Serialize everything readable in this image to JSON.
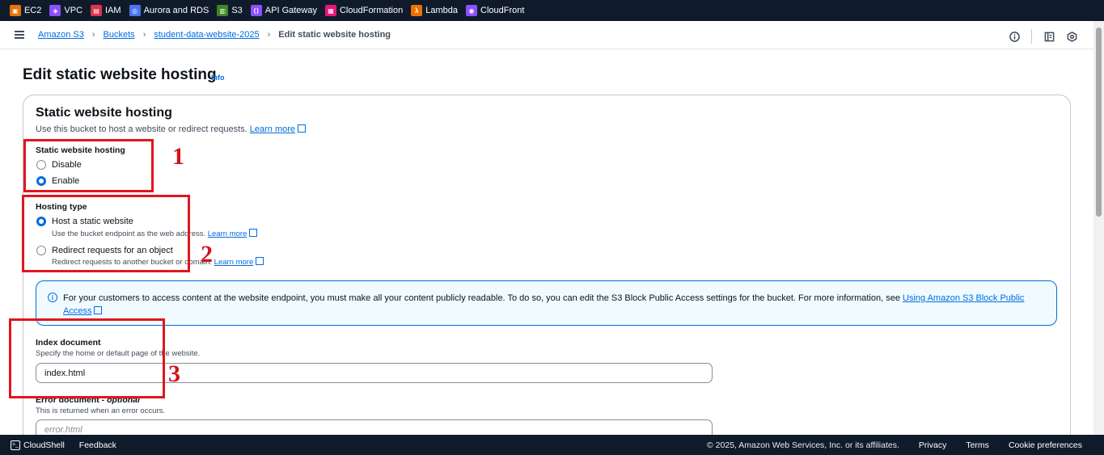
{
  "services": [
    {
      "label": "EC2",
      "color": "#ed7100",
      "icon": "ec2-icon"
    },
    {
      "label": "VPC",
      "color": "#8c4fff",
      "icon": "vpc-icon"
    },
    {
      "label": "IAM",
      "color": "#dd344c",
      "icon": "iam-icon"
    },
    {
      "label": "Aurora and RDS",
      "color": "#4d72f3",
      "icon": "rds-icon"
    },
    {
      "label": "S3",
      "color": "#3f8624",
      "icon": "s3-icon"
    },
    {
      "label": "API Gateway",
      "color": "#8c4fff",
      "icon": "api-gateway-icon"
    },
    {
      "label": "CloudFormation",
      "color": "#e7157b",
      "icon": "cloudformation-icon"
    },
    {
      "label": "Lambda",
      "color": "#ed7100",
      "icon": "lambda-icon"
    },
    {
      "label": "CloudFront",
      "color": "#8c4fff",
      "icon": "cloudfront-icon"
    }
  ],
  "breadcrumb": {
    "items": [
      "Amazon S3",
      "Buckets",
      "student-data-website-2025"
    ],
    "current": "Edit static website hosting"
  },
  "page": {
    "title": "Edit static website hosting",
    "info": "Info"
  },
  "container": {
    "title": "Static website hosting",
    "description": "Use this bucket to host a website or redirect requests.",
    "learn_more": "Learn more"
  },
  "hosting": {
    "label": "Static website hosting",
    "disable": "Disable",
    "enable": "Enable",
    "selected": "Enable"
  },
  "hosting_type": {
    "label": "Hosting type",
    "static_label": "Host a static website",
    "static_desc": "Use the bucket endpoint as the web address.",
    "redirect_label": "Redirect requests for an object",
    "redirect_desc": "Redirect requests to another bucket or domain.",
    "learn_more": "Learn more"
  },
  "alert": {
    "text": "For your customers to access content at the website endpoint, you must make all your content publicly readable. To do so, you can edit the S3 Block Public Access settings for the bucket. For more information, see",
    "link": "Using Amazon S3 Block Public Access"
  },
  "index_document": {
    "label": "Index document",
    "desc": "Specify the home or default page of the website.",
    "value": "index.html"
  },
  "error_document": {
    "label": "Error document",
    "optional": "optional",
    "desc": "This is returned when an error occurs.",
    "placeholder": "error.html"
  },
  "annotations": [
    "1",
    "2",
    "3"
  ],
  "footer": {
    "cloudshell": "CloudShell",
    "feedback": "Feedback",
    "copyright": "© 2025, Amazon Web Services, Inc. or its affiliates.",
    "privacy": "Privacy",
    "terms": "Terms",
    "cookies": "Cookie preferences"
  }
}
